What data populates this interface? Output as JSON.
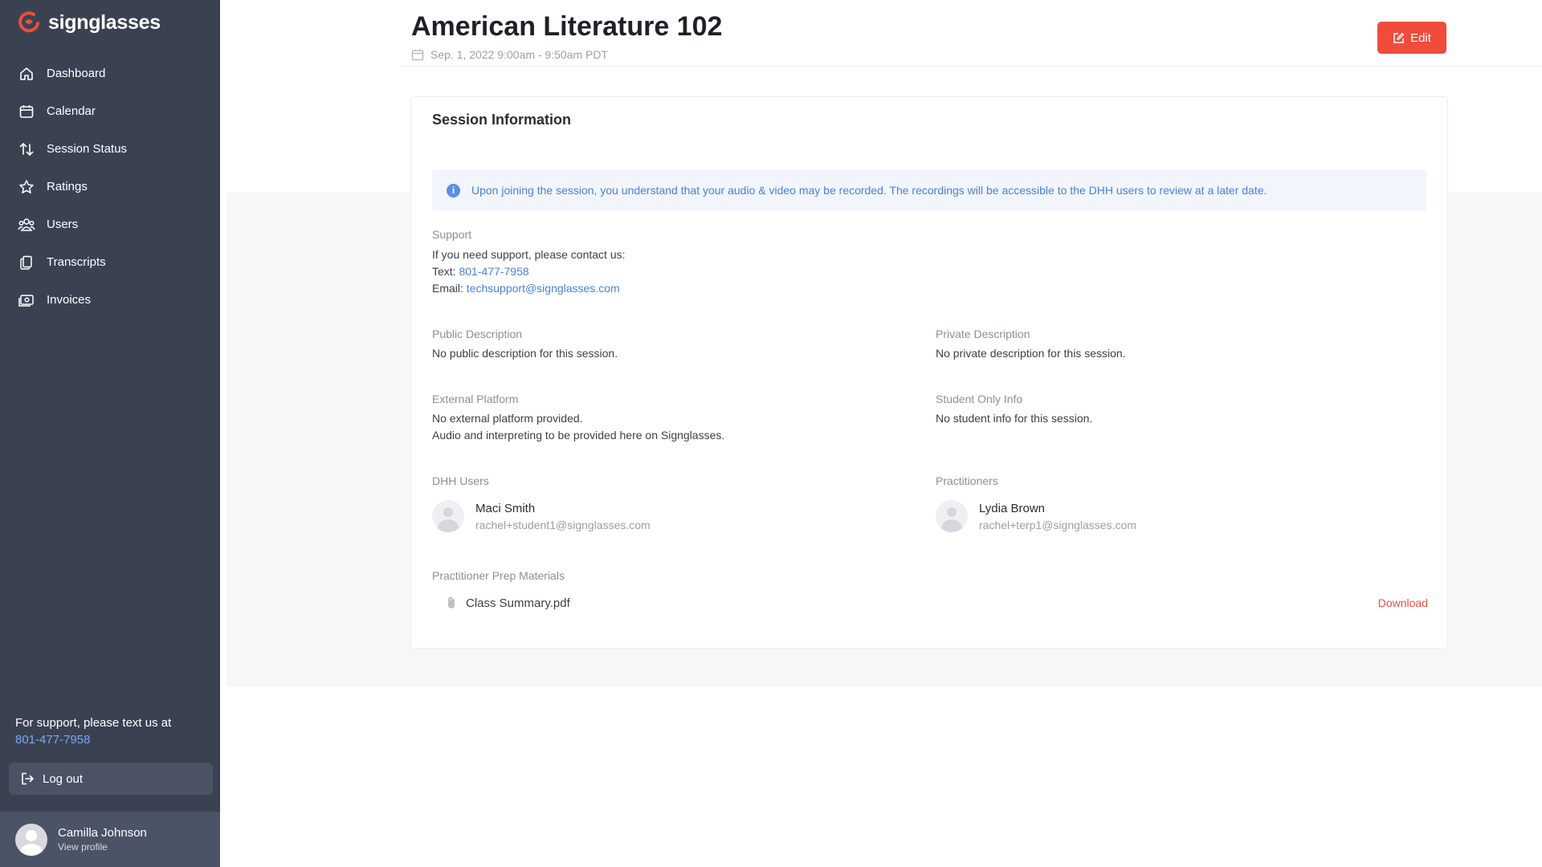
{
  "brand": {
    "name": "signglasses",
    "accent": "#ef4c3c"
  },
  "sidebar": {
    "items": [
      {
        "label": "Dashboard",
        "icon": "home-icon"
      },
      {
        "label": "Calendar",
        "icon": "calendar-icon"
      },
      {
        "label": "Session Status",
        "icon": "sort-arrows-icon"
      },
      {
        "label": "Ratings",
        "icon": "star-icon"
      },
      {
        "label": "Users",
        "icon": "users-icon"
      },
      {
        "label": "Transcripts",
        "icon": "documents-icon"
      },
      {
        "label": "Invoices",
        "icon": "invoice-icon"
      }
    ],
    "support_text": "For support, please text us at",
    "support_phone": "801-477-7958",
    "logout_label": "Log out",
    "profile": {
      "name": "Camilla Johnson",
      "link": "View profile"
    }
  },
  "header": {
    "title": "American Literature 102",
    "date": "Sep. 1, 2022 9:00am - 9:50am PDT",
    "edit_label": "Edit"
  },
  "session": {
    "title": "Session Information",
    "alert": "Upon joining the session, you understand that your audio & video may be recorded. The recordings will be accessible to the DHH users to review at a later date.",
    "support": {
      "label": "Support",
      "intro": "If you need support, please contact us:",
      "text_prefix": "Text:",
      "phone": "801-477-7958",
      "email_prefix": "Email:",
      "email": "techsupport@signglasses.com"
    },
    "public_description": {
      "label": "Public Description",
      "value": "No public description for this session."
    },
    "private_description": {
      "label": "Private Description",
      "value": "No private description for this session."
    },
    "external_platform": {
      "label": "External Platform",
      "line1": "No external platform provided.",
      "line2": "Audio and interpreting to be provided here on Signglasses."
    },
    "student_only_info": {
      "label": "Student Only Info",
      "value": "No student info for this session."
    },
    "dhh_users": {
      "label": "DHH Users",
      "people": [
        {
          "name": "Maci Smith",
          "email": "rachel+student1@signglasses.com"
        }
      ]
    },
    "practitioners": {
      "label": "Practitioners",
      "people": [
        {
          "name": "Lydia Brown",
          "email": "rachel+terp1@signglasses.com"
        }
      ]
    },
    "prep_materials": {
      "label": "Practitioner Prep Materials",
      "files": [
        {
          "name": "Class Summary.pdf",
          "action": "Download"
        }
      ]
    }
  }
}
